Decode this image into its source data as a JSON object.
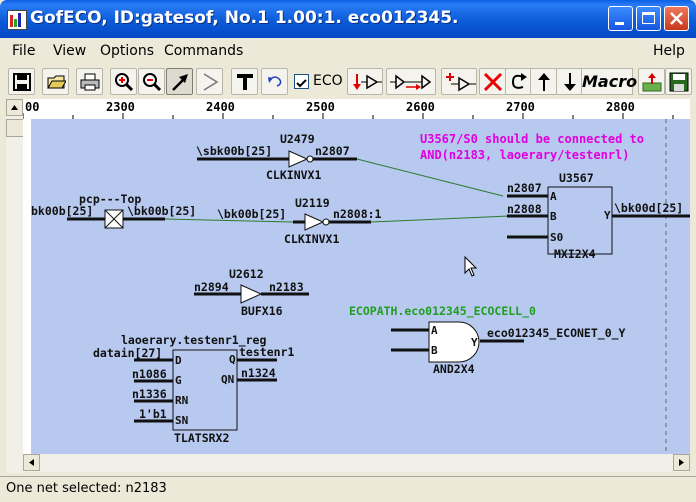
{
  "window": {
    "title": "GofECO, ID:gatesof, No.1 1.00:1. eco012345."
  },
  "menu": {
    "file": "File",
    "view": "View",
    "options": "Options",
    "commands": "Commands",
    "help": "Help"
  },
  "toolbar": {
    "eco_label": "ECO",
    "eco_checked": true,
    "macro_label": "Macro"
  },
  "ruler": {
    "ticks": [
      "00",
      "2300",
      "2400",
      "2500",
      "2600",
      "2700",
      "2800"
    ]
  },
  "schematic": {
    "comment_line1": "U3567/S0 should be connected to",
    "comment_line2": "AND(n2183, laoerary/testenrl)",
    "ecopath_label": "ECOPATH.eco012345_ECOCELL_0",
    "cells": {
      "u2479": {
        "name": "U2479",
        "type": "CLKINVX1",
        "in_net": "\\sbk00b[25]",
        "out_net": "n2807"
      },
      "u2119": {
        "name": "U2119",
        "type": "CLKINVX1",
        "in_net": "\\bk00b[25]",
        "out_net": "n2808:1"
      },
      "u3567": {
        "name": "U3567",
        "type": "MXI2X4",
        "pin_a": "A",
        "pin_b": "B",
        "pin_s0": "S0",
        "pin_y": "Y",
        "net_a": "n2807",
        "net_b": "n2808",
        "out_net": "\\bk00d[25]"
      },
      "pcp": {
        "name": "pcp---Top",
        "in_net": "bk00b[25]",
        "out_net": "\\bk00b[25]"
      },
      "u2612": {
        "name": "U2612",
        "type": "BUFX16",
        "in_net": "n2894",
        "out_net": "n2183"
      },
      "and": {
        "type": "AND2X4",
        "pin_a": "A",
        "pin_b": "B",
        "pin_y": "Y",
        "out_net": "eco012345_ECONET_0_Y"
      },
      "reg": {
        "name": "laoerary.testenr1_reg",
        "type": "TLATSRX2",
        "pin_d": "D",
        "pin_g": "G",
        "pin_rn": "RN",
        "pin_sn": "SN",
        "pin_q": "Q",
        "pin_qn": "QN",
        "net_d": "datain[27]",
        "net_g": "n1086",
        "net_rn": "n1336",
        "net_sn": "1'b1",
        "net_q": "testenr1",
        "net_qn": "n1324"
      }
    }
  },
  "status": {
    "text": "One net selected: n2183"
  },
  "colors": {
    "canvas_bg": "#b7c9ef",
    "comment": "#e000e0",
    "ecopath": "#1f9e1f",
    "wire": "#2b7a2b"
  },
  "icons": [
    "save-icon",
    "open-icon",
    "print-icon",
    "zoom-in-icon",
    "zoom-out-icon",
    "select-arrow-icon",
    "play-icon",
    "text-icon",
    "undo-icon",
    "insert-gate-icon",
    "insert-buffer-icon",
    "add-gate-icon",
    "delete-icon",
    "rotate-icon",
    "arrow-up-icon",
    "arrow-down-icon",
    "export-icon",
    "save-disk-icon"
  ]
}
